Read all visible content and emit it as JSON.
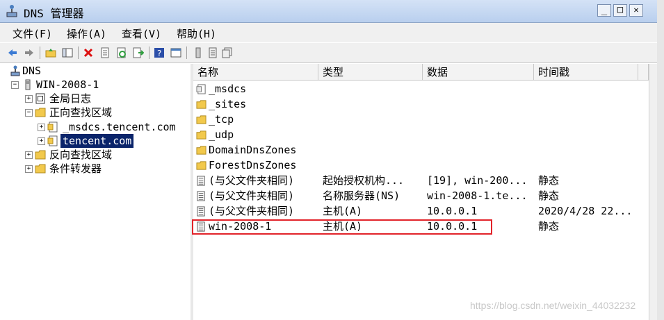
{
  "window": {
    "title": "DNS 管理器",
    "min": "_",
    "max": "□",
    "close": "✕"
  },
  "menu": [
    "文件(F)",
    "操作(A)",
    "查看(V)",
    "帮助(H)"
  ],
  "toolbar_icons": [
    "back-icon",
    "forward-icon",
    "up-folder-icon",
    "show-hide-tree-icon",
    "delete-icon",
    "properties-icon",
    "refresh-icon",
    "export-icon",
    "help-icon",
    "view-icon",
    "server-icon",
    "zone-list-icon",
    "copy-icon"
  ],
  "tree": [
    {
      "label": "DNS",
      "icon": "dns-server-icon"
    },
    {
      "label": "WIN-2008-1",
      "icon": "server-icon",
      "expander": "−"
    },
    {
      "label": "全局日志",
      "icon": "log-icon",
      "expander": "+"
    },
    {
      "label": "正向查找区域",
      "icon": "folder-icon",
      "expander": "−"
    },
    {
      "label": "_msdcs.tencent.com",
      "icon": "zone-icon",
      "expander": "+"
    },
    {
      "label": "tencent.com",
      "icon": "zone-icon",
      "expander": "+",
      "selected": true
    },
    {
      "label": "反向查找区域",
      "icon": "folder-icon",
      "expander": "+"
    },
    {
      "label": "条件转发器",
      "icon": "folder-icon",
      "expander": "+"
    }
  ],
  "columns": [
    "名称",
    "类型",
    "数据",
    "时间戳"
  ],
  "rows": [
    {
      "name": "_msdcs",
      "type": "",
      "data": "",
      "timestamp": "",
      "icon": "zone-icon"
    },
    {
      "name": "_sites",
      "type": "",
      "data": "",
      "timestamp": "",
      "icon": "folder-icon"
    },
    {
      "name": "_tcp",
      "type": "",
      "data": "",
      "timestamp": "",
      "icon": "folder-icon"
    },
    {
      "name": "_udp",
      "type": "",
      "data": "",
      "timestamp": "",
      "icon": "folder-icon"
    },
    {
      "name": "DomainDnsZones",
      "type": "",
      "data": "",
      "timestamp": "",
      "icon": "folder-icon"
    },
    {
      "name": "ForestDnsZones",
      "type": "",
      "data": "",
      "timestamp": "",
      "icon": "folder-icon"
    },
    {
      "name": "(与父文件夹相同)",
      "type": "起始授权机构...",
      "data": "[19], win-200...",
      "timestamp": "静态",
      "icon": "record-icon"
    },
    {
      "name": "(与父文件夹相同)",
      "type": "名称服务器(NS)",
      "data": "win-2008-1.te...",
      "timestamp": "静态",
      "icon": "record-icon"
    },
    {
      "name": "(与父文件夹相同)",
      "type": "主机(A)",
      "data": "10.0.0.1",
      "timestamp": "2020/4/28 22...",
      "icon": "record-icon"
    },
    {
      "name": "win-2008-1",
      "type": "主机(A)",
      "data": "10.0.0.1",
      "timestamp": "静态",
      "icon": "record-icon",
      "highlighted": true
    }
  ],
  "watermark": "https://blog.csdn.net/weixin_44032232",
  "colors": {
    "selection": "#0a246a",
    "highlight_box": "#e2232a",
    "folder": "#f2c94c"
  }
}
